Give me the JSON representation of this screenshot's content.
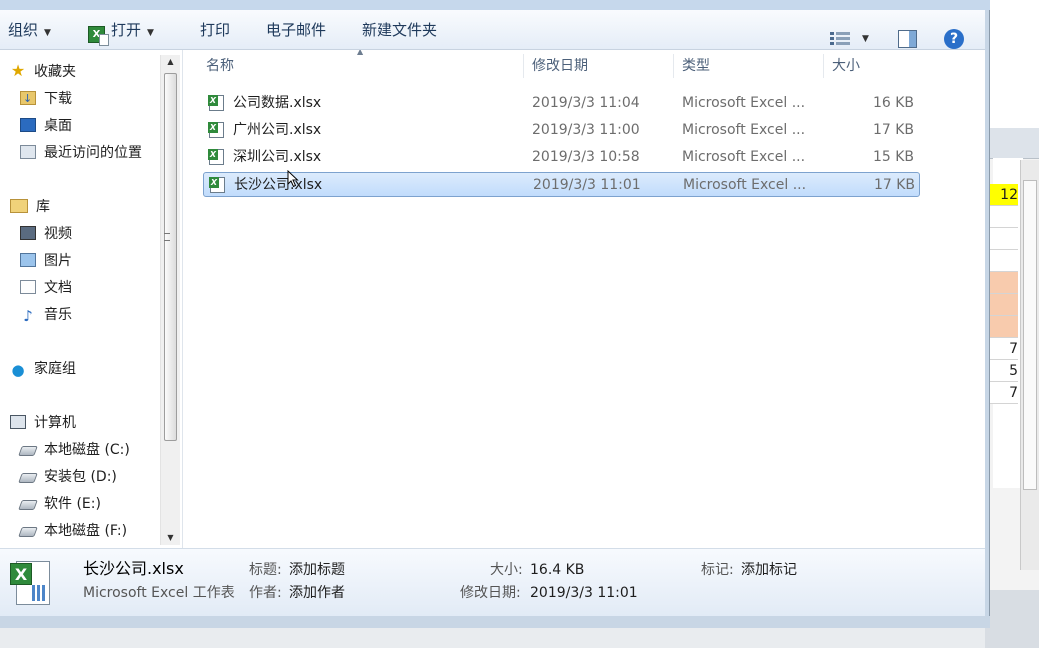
{
  "toolbar": {
    "organize": "组织",
    "open": "打开",
    "print": "打印",
    "email": "电子邮件",
    "new_folder": "新建文件夹"
  },
  "nav": {
    "favorites": "收藏夹",
    "downloads": "下载",
    "desktop": "桌面",
    "recent": "最近访问的位置",
    "libraries": "库",
    "videos": "视频",
    "pictures": "图片",
    "documents": "文档",
    "music": "音乐",
    "homegroup": "家庭组",
    "computer": "计算机",
    "drive_c": "本地磁盘 (C:)",
    "drive_d": "安装包 (D:)",
    "drive_e": "软件 (E:)",
    "drive_f": "本地磁盘 (F:)"
  },
  "columns": {
    "name": "名称",
    "date": "修改日期",
    "type": "类型",
    "size": "大小"
  },
  "files": [
    {
      "name": "公司数据.xlsx",
      "date": "2019/3/3 11:04",
      "type": "Microsoft Excel ...",
      "size": "16 KB"
    },
    {
      "name": "广州公司.xlsx",
      "date": "2019/3/3 11:00",
      "type": "Microsoft Excel ...",
      "size": "17 KB"
    },
    {
      "name": "深圳公司.xlsx",
      "date": "2019/3/3 10:58",
      "type": "Microsoft Excel ...",
      "size": "15 KB"
    },
    {
      "name": "长沙公司.xlsx",
      "date": "2019/3/3 11:01",
      "type": "Microsoft Excel ...",
      "size": "17 KB"
    }
  ],
  "details": {
    "file_name": "长沙公司.xlsx",
    "file_type": "Microsoft Excel 工作表",
    "title_label": "标题:",
    "title_value": "添加标题",
    "author_label": "作者:",
    "author_value": "添加作者",
    "size_label": "大小:",
    "size_value": "16.4 KB",
    "modified_label": "修改日期:",
    "modified_value": "2019/3/3 11:01",
    "tags_label": "标记:",
    "tags_value": "添加标记"
  },
  "background_excel": {
    "cells": [
      "12",
      "7",
      "5",
      "7"
    ],
    "colors": {
      "yellow": "#ffff00",
      "peach": "#f8cbad"
    }
  },
  "icons": {
    "help": "?"
  }
}
